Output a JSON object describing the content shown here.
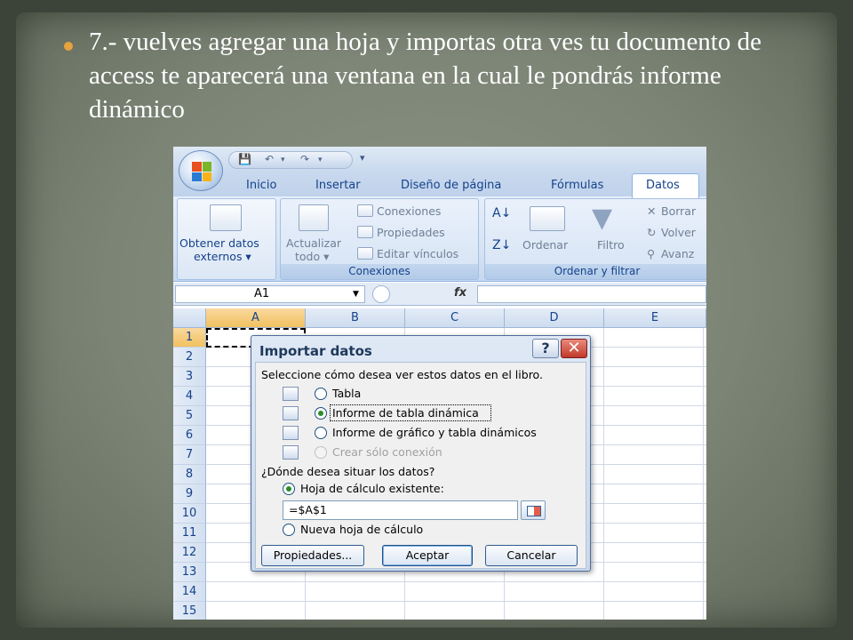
{
  "slide": {
    "text": "7.- vuelves agregar una hoja y importas otra ves tu documento de access te aparecerá una ventana en la cual le pondrás informe dinámico"
  },
  "excel": {
    "qat": {
      "more": "▾"
    },
    "tabs": [
      "Inicio",
      "Insertar",
      "Diseño de página",
      "Fórmulas",
      "Datos"
    ],
    "ribbon": {
      "get_external_line1": "Obtener datos",
      "get_external_line2": "externos ▾",
      "refresh_line1": "Actualizar",
      "refresh_line2": "todo ▾",
      "connections": "Conexiones",
      "properties": "Propiedades",
      "edit_links": "Editar vínculos",
      "connections_group": "Conexiones",
      "sort": "Ordenar",
      "filter": "Filtro",
      "clear": "Borrar",
      "reapply": "Volver",
      "advanced": "Avanz",
      "sort_filter_group": "Ordenar y filtrar"
    },
    "formula_bar": {
      "name_box": "A1",
      "fx": "fx"
    },
    "columns": [
      "A",
      "B",
      "C",
      "D",
      "E"
    ],
    "rows": [
      "1",
      "2",
      "3",
      "4",
      "5",
      "6",
      "7",
      "8",
      "9",
      "10",
      "11",
      "12",
      "13",
      "14",
      "15"
    ]
  },
  "dialog": {
    "title": "Importar datos",
    "help": "?",
    "close": "✕",
    "prompt": "Seleccione cómo desea ver estos datos en el libro.",
    "options": [
      {
        "label": "Tabla",
        "checked": false,
        "disabled": false
      },
      {
        "label": "Informe de tabla dinámica",
        "checked": true,
        "disabled": false
      },
      {
        "label": "Informe de gráfico y tabla dinámicos",
        "checked": false,
        "disabled": false
      },
      {
        "label": "Crear sólo conexión",
        "checked": false,
        "disabled": true
      }
    ],
    "location_prompt": "¿Dónde desea situar los datos?",
    "existing_sheet": "Hoja de cálculo existente:",
    "reference": "=$A$1",
    "new_sheet": "Nueva hoja de cálculo",
    "buttons": {
      "properties": "Propiedades...",
      "accept": "Aceptar",
      "cancel": "Cancelar"
    }
  },
  "colors": {
    "bullet": "#e8a33c",
    "ribbon_text": "#15428b",
    "slide_bg": "#7c8475"
  }
}
